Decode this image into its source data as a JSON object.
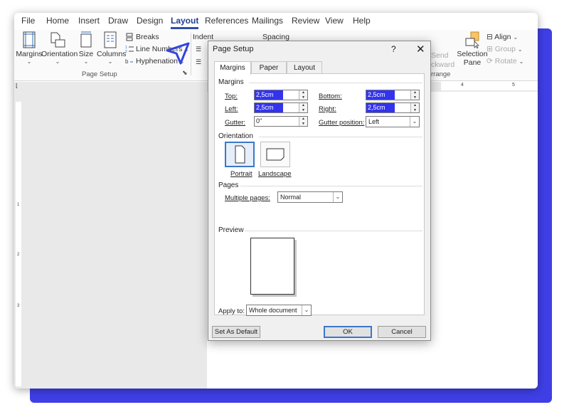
{
  "menu": {
    "tabs": [
      "File",
      "Home",
      "Insert",
      "Draw",
      "Design",
      "Layout",
      "References",
      "Mailings",
      "Review",
      "View",
      "Help"
    ],
    "active": "Layout"
  },
  "ribbon": {
    "page_setup": {
      "margins": "Margins",
      "orientation": "Orientation",
      "size": "Size",
      "columns": "Columns",
      "breaks": "Breaks",
      "line_numbers": "Line Numbers",
      "hyphenation": "Hyphenation",
      "group_label": "Page Setup"
    },
    "paragraph": {
      "indent": "Indent",
      "spacing": "Spacing"
    },
    "arrange": {
      "send_backward": "Send",
      "send_backward_2": "ckward",
      "selection_pane": "Selection",
      "selection_pane_2": "Pane",
      "align": "Align",
      "group": "Group",
      "rotate": "Rotate",
      "group_label": "rrange"
    }
  },
  "ruler": {
    "h_marks": [
      "4",
      "5"
    ],
    "v_marks": [
      "1",
      "2",
      "3"
    ]
  },
  "dialog": {
    "title": "Page Setup",
    "help": "?",
    "close": "✕",
    "tabs": [
      "Margins",
      "Paper",
      "Layout"
    ],
    "active_tab": "Margins",
    "margins_section": "Margins",
    "top_label": "Top:",
    "top_value": "2,5cm",
    "bottom_label": "Bottom:",
    "bottom_value": "2,5cm",
    "left_label": "Left:",
    "left_value": "2,5cm",
    "right_label": "Right:",
    "right_value": "2,5cm",
    "gutter_label": "Gutter:",
    "gutter_value": "0\"",
    "gutter_position_label": "Gutter position:",
    "gutter_position_value": "Left",
    "orientation_section": "Orientation",
    "portrait": "Portrait",
    "landscape": "Landscape",
    "pages_section": "Pages",
    "multiple_pages_label": "Multiple pages:",
    "multiple_pages_value": "Normal",
    "preview_section": "Preview",
    "apply_to_label": "Apply to:",
    "apply_to_value": "Whole document",
    "set_default": "Set As Default",
    "ok": "OK",
    "cancel": "Cancel"
  },
  "colors": {
    "accent": "#2f4ea8",
    "selection": "#3333ee",
    "backdrop": "#3f3fe6",
    "cursor": "#3344dd"
  }
}
